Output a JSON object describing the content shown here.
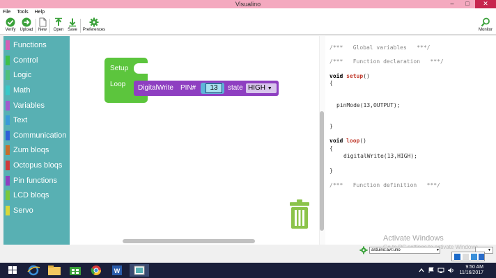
{
  "window": {
    "title": "Visualino"
  },
  "menu": [
    "File",
    "Tools",
    "Help"
  ],
  "toolbar": {
    "verify": "Verify",
    "upload": "Upload",
    "new": "New",
    "open": "Open",
    "save": "Save",
    "preferences": "Preferences",
    "monitor": "Monitor"
  },
  "sidebar": {
    "categories": [
      {
        "label": "Functions",
        "color": "#d35fb7"
      },
      {
        "label": "Control",
        "color": "#3fc04a"
      },
      {
        "label": "Logic",
        "color": "#4fc07a"
      },
      {
        "label": "Math",
        "color": "#38c8c8"
      },
      {
        "label": "Variables",
        "color": "#a05ad0"
      },
      {
        "label": "Text",
        "color": "#3a9ad9"
      },
      {
        "label": "Communication",
        "color": "#2f5fd8"
      },
      {
        "label": "Zum bloqs",
        "color": "#c86e2a"
      },
      {
        "label": "Octopus bloqs",
        "color": "#d03a3a"
      },
      {
        "label": "Pin functions",
        "color": "#8e3fc1"
      },
      {
        "label": "LCD bloqs",
        "color": "#7ac83a"
      },
      {
        "label": "Servo",
        "color": "#d8d83a"
      }
    ]
  },
  "blocks": {
    "setup": "Setup",
    "loop": "Loop",
    "digitalwrite": "DigitalWrite",
    "pin_label": "PIN#",
    "pin_value": "13",
    "state_label": "state",
    "state_value": "HIGH"
  },
  "code": {
    "l1": "/***   Global variables   ***/",
    "l2": "/***   Function declaration   ***/",
    "setup_kw": "void",
    "setup_fn": "setup",
    "setup_rest": "()",
    "brace_open": "{",
    "pinmode": "pinMode(13,OUTPUT);",
    "brace_close": "}",
    "loop_kw": "void",
    "loop_fn": "loop",
    "loop_rest": "()",
    "digitalwrite": "digitalWrite(13,HIGH);",
    "l_def": "/***   Function definition   ***/"
  },
  "status": {
    "board": "arduino:avr:uno",
    "activate_title": "Activate Windows",
    "activate_sub": "Go to PC settings to activate Windows."
  },
  "taskbar": {
    "time": "9:50 AM",
    "date": "11/16/2017"
  }
}
